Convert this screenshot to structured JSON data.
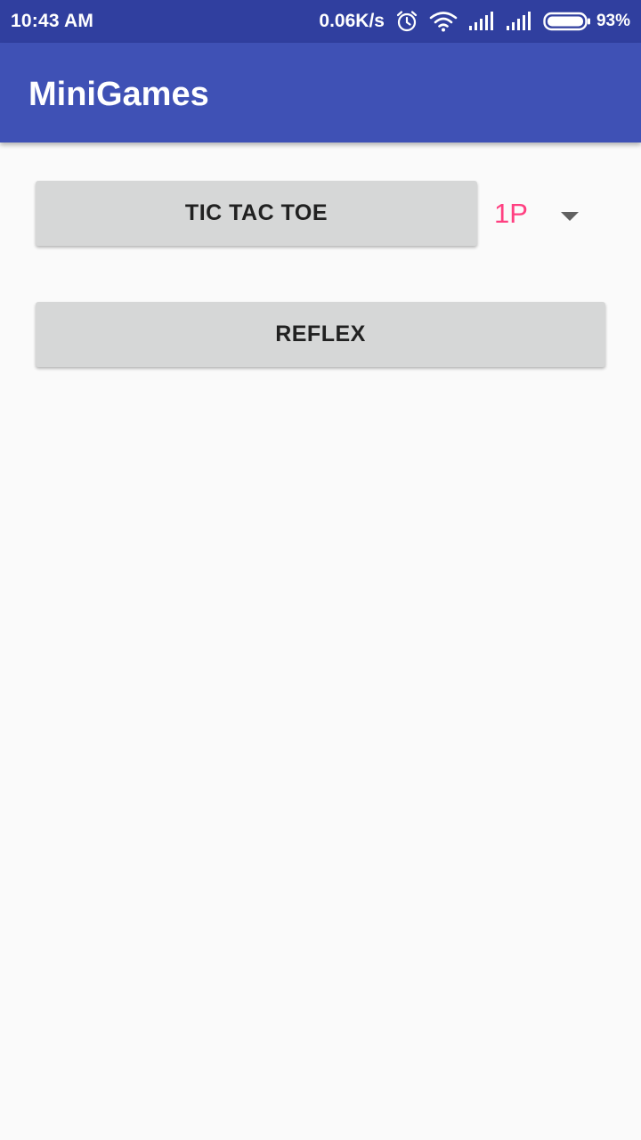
{
  "status_bar": {
    "time": "10:43 AM",
    "net_speed": "0.06K/s",
    "battery_percent": "93%",
    "battery_level": 0.93,
    "icons": [
      "alarm-icon",
      "wifi-icon",
      "signal-icon",
      "signal-icon",
      "battery-icon"
    ]
  },
  "app_bar": {
    "title": "MiniGames"
  },
  "main": {
    "tic_tac_toe_label": "TIC TAC TOE",
    "players_spinner": {
      "selected": "1P"
    },
    "reflex_label": "REFLEX"
  },
  "colors": {
    "status_bar": "#303f9f",
    "app_bar": "#3f51b5",
    "accent": "#ff4081",
    "button_bg": "#d6d7d7",
    "background": "#fafafa"
  }
}
